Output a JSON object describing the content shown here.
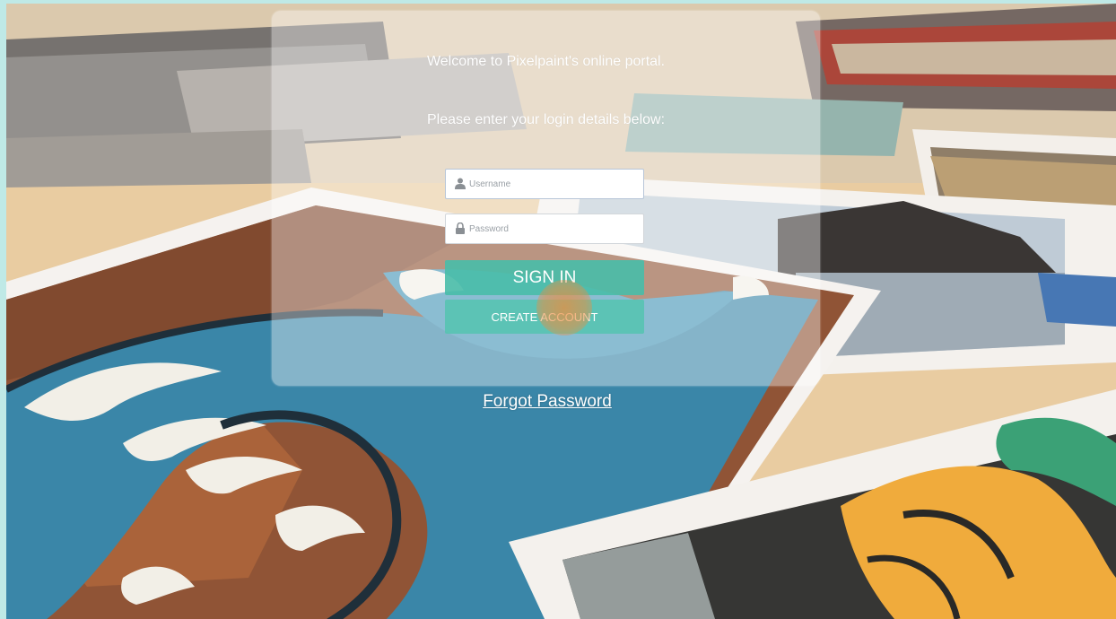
{
  "login": {
    "welcome_text": "Welcome to Pixelpaint's online portal.",
    "instructions_text": "Please enter your login details below:",
    "username_placeholder": "Username",
    "password_placeholder": "Password",
    "sign_in_label": "SIGN IN",
    "create_account_label": "CREATE ACCOUNT",
    "forgot_password_label": "Forgot Password"
  },
  "icons": {
    "username": "user-icon",
    "password": "lock-icon"
  },
  "colors": {
    "accent": "#48bca8",
    "frame": "#bfe9e6",
    "card": "rgba(255,255,255,0.38)",
    "click_marker": "#ee8c3c"
  }
}
